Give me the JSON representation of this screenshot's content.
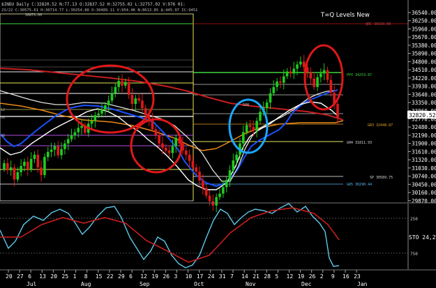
{
  "header": {
    "symbol_line": "$INDU Daily C:32820.52 N:77.13 O:32837.52 H:32755.02 L:32757.02 V:976 01:",
    "ohlc_line": "23/22 C:30575.61 H:30714.77 L:30254.80 O:30489.11 V:954.4K N:8613.85 Δ:445.97 IC:9451",
    "indicator_title": "T=Q Levels New"
  },
  "price_axis": {
    "labels": [
      "36540.00",
      "36250.00",
      "35960.00",
      "35670.00",
      "35380.00",
      "35090.00",
      "34800.00",
      "34510.00",
      "34220.00",
      "33930.00",
      "33640.00",
      "33350.00",
      "33060.00",
      "32770.00",
      "32480.00",
      "32190.00",
      "31900.00",
      "31610.00",
      "31320.00",
      "31030.00",
      "30740.00",
      "30450.00",
      "30160.00",
      "29870.00"
    ],
    "current_price": "32820.52"
  },
  "stochastic": {
    "levels": [
      "250",
      "750"
    ],
    "label": "STO 24,2"
  },
  "time_axis": {
    "day_labels": [
      "20",
      "27",
      "6",
      "13",
      "20",
      "25",
      "1",
      "8",
      "15",
      "22",
      "29",
      "6",
      "12",
      "19",
      "26",
      "3",
      "10",
      "17",
      "24",
      "31",
      "7",
      "14",
      "21",
      "28",
      "5",
      "12",
      "19",
      "26",
      "2",
      "9",
      "16",
      "23"
    ],
    "month_labels": [
      "Jul",
      "Aug",
      "Sep",
      "Oct",
      "Nov",
      "Dec",
      "Jan"
    ]
  },
  "annotations": {
    "box_label": "36873.00",
    "level_top": "QRC 36150.00",
    "level_green": "PPV 34253.87",
    "level_orange": "GR3 32448.87",
    "level_g4": "GH4 31811.93",
    "level_sp": "SP 30589.75",
    "level_gr5": "GR5 30290.44",
    "marker_500": "500",
    "left_markers": [
      "12",
      "08",
      "48"
    ]
  },
  "colors": {
    "background": "#000000",
    "up_candle": "#1ecc1e",
    "down_candle": "#e01818",
    "red_ma": "#c81e1e",
    "orange_ma": "#e88a18",
    "blue_ma": "#1a52ff",
    "white_ma": "#ffffff",
    "green_level": "#3ed83e",
    "yellow_level": "#e8e85a",
    "magenta_level": "#b24ee0",
    "highlight_red": "#e01818",
    "highlight_blue": "#1aa8ff",
    "osc_cyan": "#5ec8e8",
    "osc_red": "#c81e1e"
  }
}
